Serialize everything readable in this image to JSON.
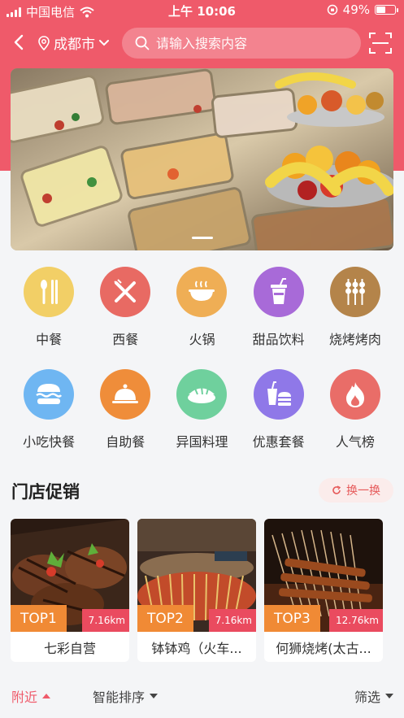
{
  "status_bar": {
    "carrier": "中国电信",
    "time": "上午 10:06",
    "battery": "49%",
    "battery_level": 0.49
  },
  "header": {
    "city": "成都市",
    "search_placeholder": "请输入搜索内容"
  },
  "categories": [
    {
      "label": "中餐",
      "icon": "chopsticks-spoon-icon",
      "color": "#f2cf66"
    },
    {
      "label": "西餐",
      "icon": "fork-knife-icon",
      "color": "#e86a63"
    },
    {
      "label": "火锅",
      "icon": "hotpot-bowl-icon",
      "color": "#efae55"
    },
    {
      "label": "甜品饮料",
      "icon": "drink-cup-icon",
      "color": "#a86ad8"
    },
    {
      "label": "烧烤烤肉",
      "icon": "skewer-icon",
      "color": "#b4844a"
    },
    {
      "label": "小吃快餐",
      "icon": "burger-icon",
      "color": "#6fb6f2"
    },
    {
      "label": "自助餐",
      "icon": "cloche-icon",
      "color": "#ef8d3a"
    },
    {
      "label": "异国料理",
      "icon": "sushi-icon",
      "color": "#6fd09d"
    },
    {
      "label": "优惠套餐",
      "icon": "combo-meal-icon",
      "color": "#8f78e8"
    },
    {
      "label": "人气榜",
      "icon": "flame-icon",
      "color": "#e96d68"
    }
  ],
  "promo": {
    "title": "门店促销",
    "refresh_label": "换一换",
    "shops": [
      {
        "rank": "TOP1",
        "distance": "7.16km",
        "name": "七彩自营"
      },
      {
        "rank": "TOP2",
        "distance": "7.16km",
        "name": "钵钵鸡（火车..."
      },
      {
        "rank": "TOP3",
        "distance": "12.76km",
        "name": "何狮烧烤(太古..."
      }
    ]
  },
  "filters": {
    "nearby": "附近",
    "sort": "智能排序",
    "filter": "筛选"
  },
  "colors": {
    "brand": "#ef5a6a",
    "accent_orange": "#f08a35"
  }
}
